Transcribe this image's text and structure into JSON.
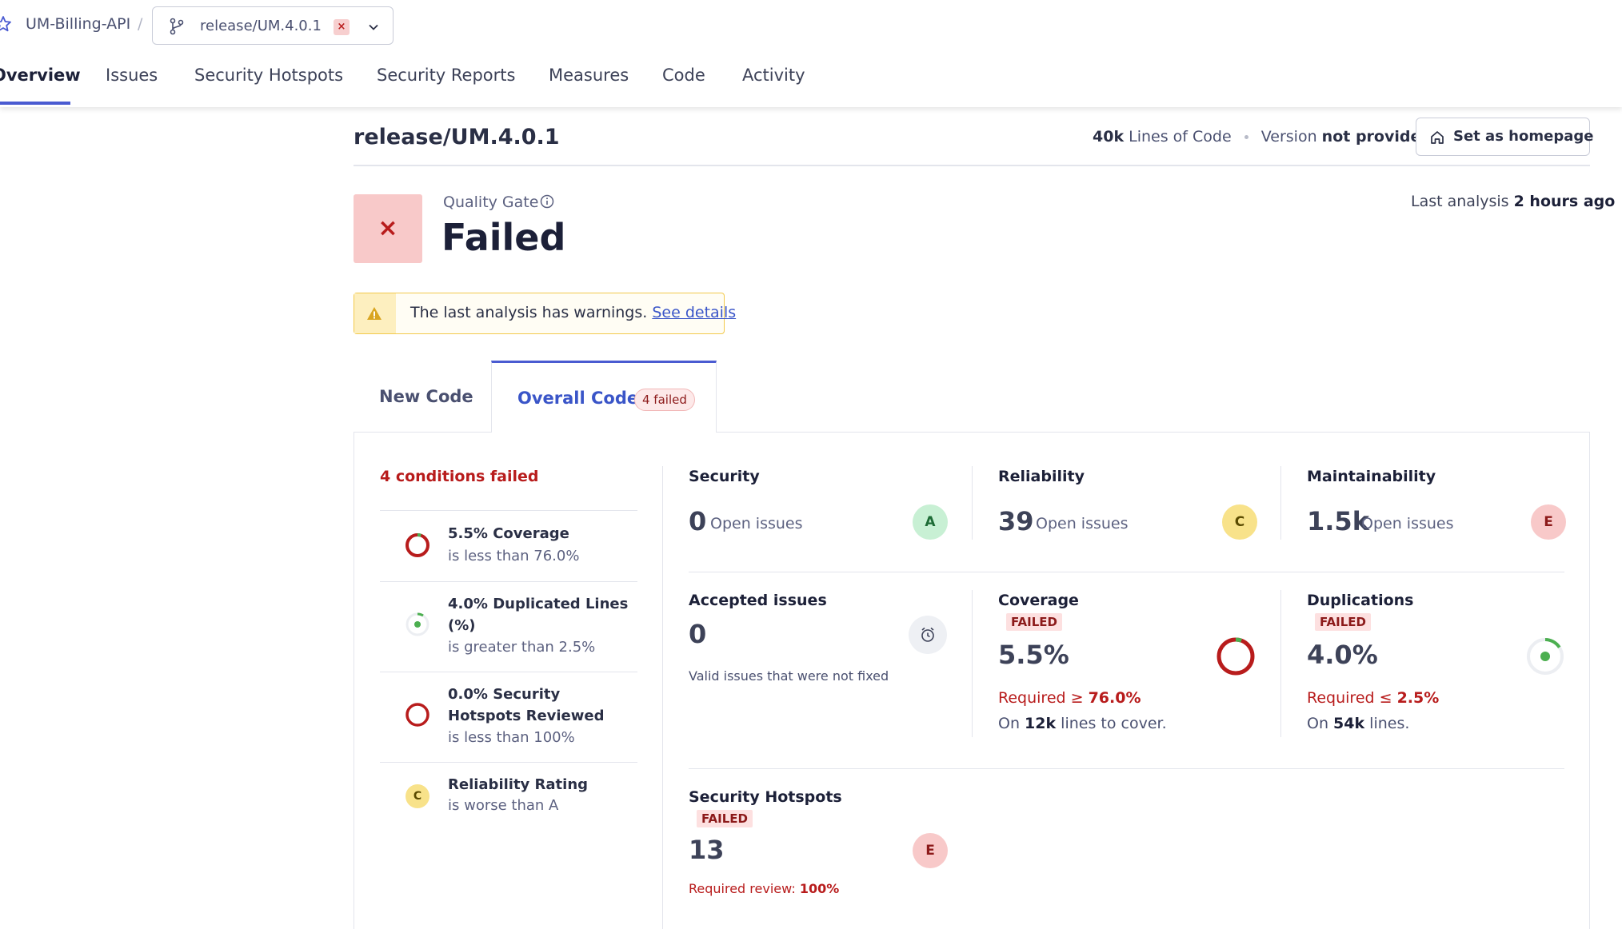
{
  "header": {
    "project_name": "UM-Billing-API",
    "crumb_separator": "/",
    "branch_name": "release/UM.4.0.1",
    "branch_close": "×"
  },
  "nav": {
    "items": [
      {
        "label": "Overview",
        "active": true
      },
      {
        "label": "Issues"
      },
      {
        "label": "Security Hotspots"
      },
      {
        "label": "Security Reports"
      },
      {
        "label": "Measures"
      },
      {
        "label": "Code"
      },
      {
        "label": "Activity"
      }
    ]
  },
  "page": {
    "title": "release/UM.4.0.1",
    "loc_value": "40k",
    "loc_label": "Lines of Code",
    "version_label": "Version",
    "version_value": "not provided",
    "homepage_button": "Set as homepage"
  },
  "quality_gate": {
    "label": "Quality Gate",
    "status": "Failed",
    "status_icon": "×",
    "last_analysis_label": "Last analysis",
    "last_analysis_value": "2 hours ago"
  },
  "warning": {
    "text": "The last analysis has warnings.",
    "link": "See details"
  },
  "tabs": {
    "new_code": "New Code",
    "overall_code": "Overall Code",
    "overall_badge": "4 failed"
  },
  "conditions": {
    "heading": "4 conditions failed",
    "items": [
      {
        "title": "5.5% Coverage",
        "sub": "is less than 76.0%"
      },
      {
        "title": "4.0% Duplicated Lines (%)",
        "sub": "is greater than 2.5%"
      },
      {
        "title": "0.0% Security Hotspots Reviewed",
        "sub": "is less than 100%"
      },
      {
        "title": "Reliability Rating",
        "sub": "is worse than A",
        "rating": "C"
      }
    ]
  },
  "metrics": {
    "security": {
      "title": "Security",
      "value": "0",
      "unit": "Open issues",
      "grade": "A"
    },
    "reliability": {
      "title": "Reliability",
      "value": "39",
      "unit": "Open issues",
      "grade": "C"
    },
    "maintainability": {
      "title": "Maintainability",
      "value": "1.5k",
      "unit": "Open issues",
      "grade": "E"
    },
    "accepted": {
      "title": "Accepted issues",
      "value": "0",
      "note": "Valid issues that were not fixed"
    },
    "coverage": {
      "title": "Coverage",
      "tag": "FAILED",
      "value": "5.5%",
      "required_label": "Required ≥",
      "required_value": "76.0%",
      "on_label": "On",
      "on_value": "12k",
      "on_suffix": "lines to cover.",
      "percent": 5.5
    },
    "duplications": {
      "title": "Duplications",
      "tag": "FAILED",
      "value": "4.0%",
      "required_label": "Required ≤",
      "required_value": "2.5%",
      "on_label": "On",
      "on_value": "54k",
      "on_suffix": "lines.",
      "percent": 4.0
    },
    "hotspots": {
      "title": "Security Hotspots",
      "tag": "FAILED",
      "value": "13",
      "grade": "E",
      "required_label": "Required review:",
      "required_value": "100%"
    }
  },
  "colors": {
    "accent": "#4a5bd1",
    "error": "#b81c1c",
    "warning": "#f2c94c",
    "success": "#4caf50"
  }
}
